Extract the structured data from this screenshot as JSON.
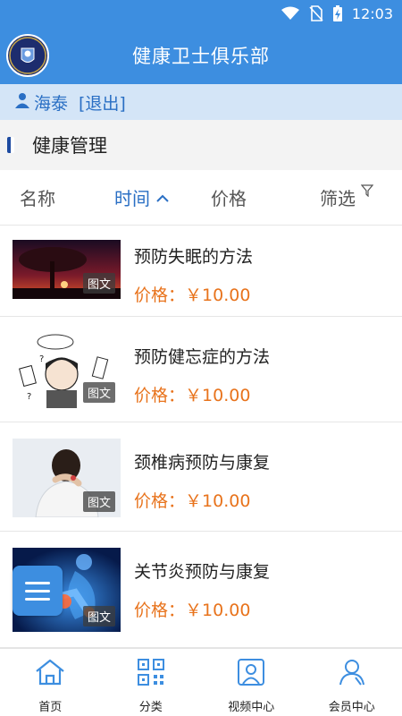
{
  "status_bar": {
    "time": "12:03",
    "icons": [
      "wifi-icon",
      "no-sim-icon",
      "battery-charging-icon"
    ]
  },
  "header": {
    "title": "健康卫士俱乐部",
    "logo": {
      "text_top": "HAI TAI",
      "text_bottom": "HEALTH"
    }
  },
  "user": {
    "name": "海泰",
    "logout_label": "[退出]"
  },
  "section": {
    "title": "健康管理"
  },
  "sort_bar": {
    "name": "名称",
    "time": "时间",
    "price": "价格",
    "filter": "筛选",
    "active": "时间"
  },
  "items": [
    {
      "title": "预防失眠的方法",
      "price_label": "价格：",
      "price": "￥10.00",
      "tag": "图文"
    },
    {
      "title": "预防健忘症的方法",
      "price_label": "价格：",
      "price": "￥10.00",
      "tag": "图文"
    },
    {
      "title": "颈椎病预防与康复",
      "price_label": "价格：",
      "price": "￥10.00",
      "tag": "图文"
    },
    {
      "title": "关节炎预防与康复",
      "price_label": "价格：",
      "price": "￥10.00",
      "tag": "图文"
    }
  ],
  "bottom_nav": [
    {
      "label": "首页",
      "icon": "home-icon"
    },
    {
      "label": "分类",
      "icon": "qr-code-icon"
    },
    {
      "label": "视频中心",
      "icon": "video-portrait-icon"
    },
    {
      "label": "会员中心",
      "icon": "member-icon"
    }
  ],
  "colors": {
    "primary": "#3d8ee0",
    "user_bar": "#d4e5f7",
    "price": "#e8731c",
    "active_sort": "#2a6fc4"
  }
}
